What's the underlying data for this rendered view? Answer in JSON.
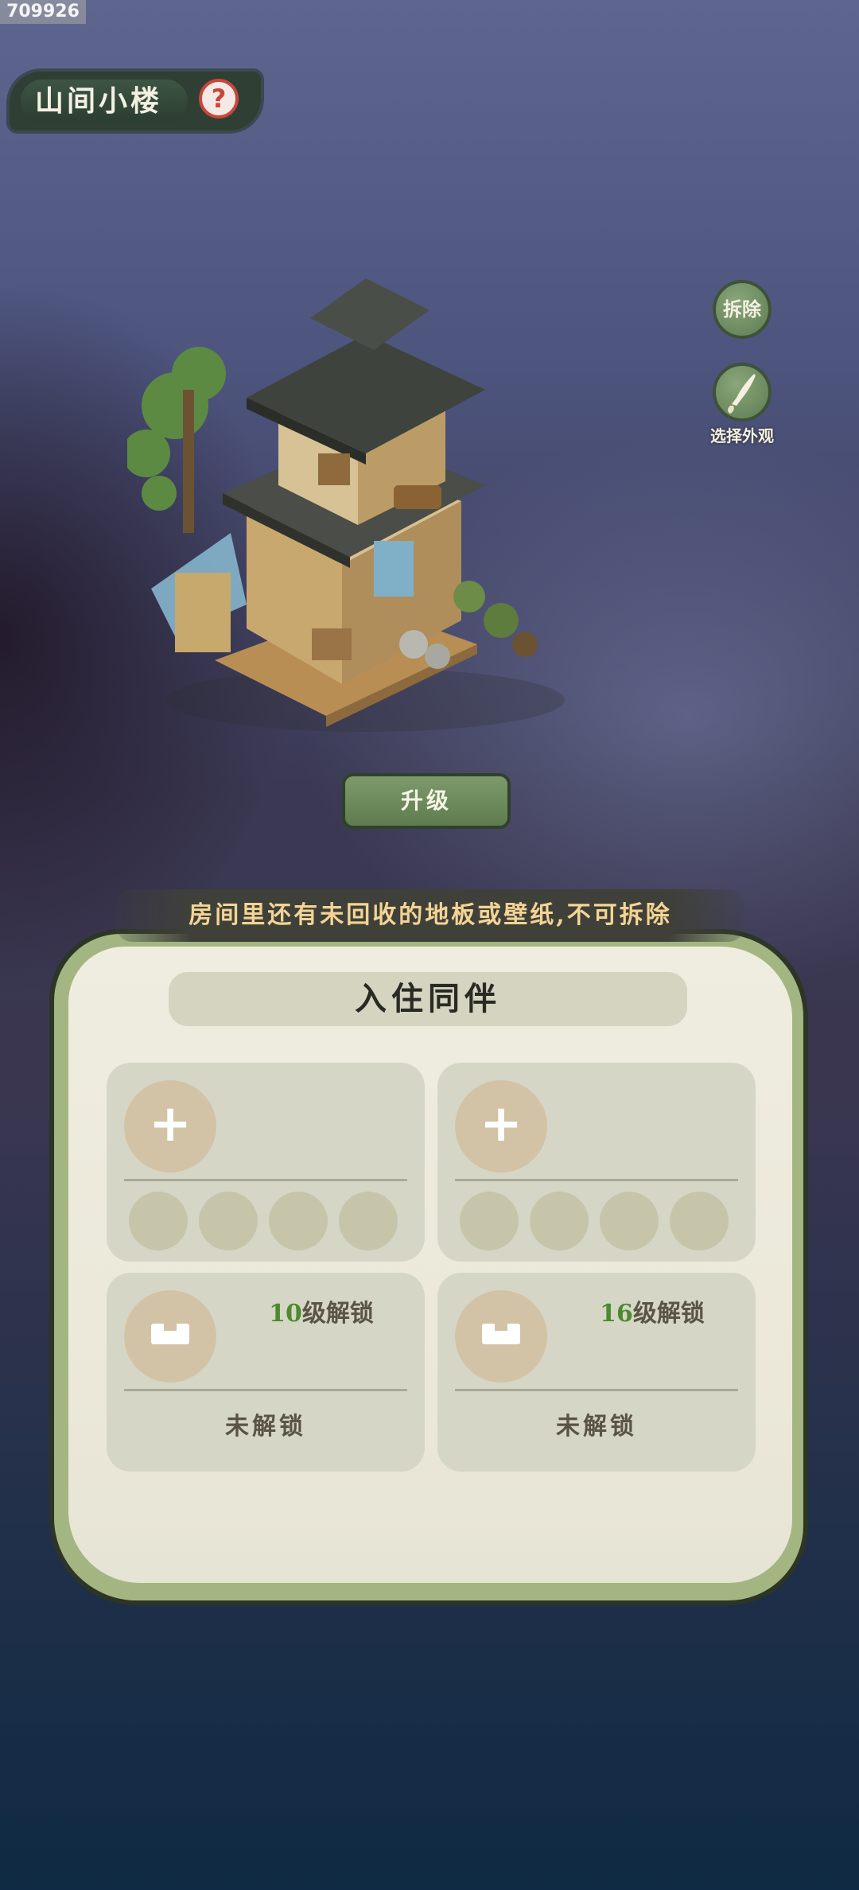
{
  "watermark_id": "709926",
  "header": {
    "title": "山间小楼",
    "help_symbol": "?"
  },
  "actions": {
    "demolish_label": "拆除",
    "appearance_label": "选择外观"
  },
  "upgrade_label": "升级",
  "notice": "房间里还有未回收的地板或壁纸,不可拆除",
  "panel": {
    "title": "入住同伴",
    "open_slots": [
      {
        "plus": "+"
      },
      {
        "plus": "+"
      }
    ],
    "locked_slots": [
      {
        "level": "10",
        "level_suffix": "级解锁",
        "status": "未解锁"
      },
      {
        "level": "16",
        "level_suffix": "级解锁",
        "status": "未解锁"
      }
    ]
  },
  "colors": {
    "accent_green": "#5e7c4f",
    "notice_text": "#f3d494",
    "level_number": "#4c8a2c",
    "help_red": "#c9463c"
  }
}
